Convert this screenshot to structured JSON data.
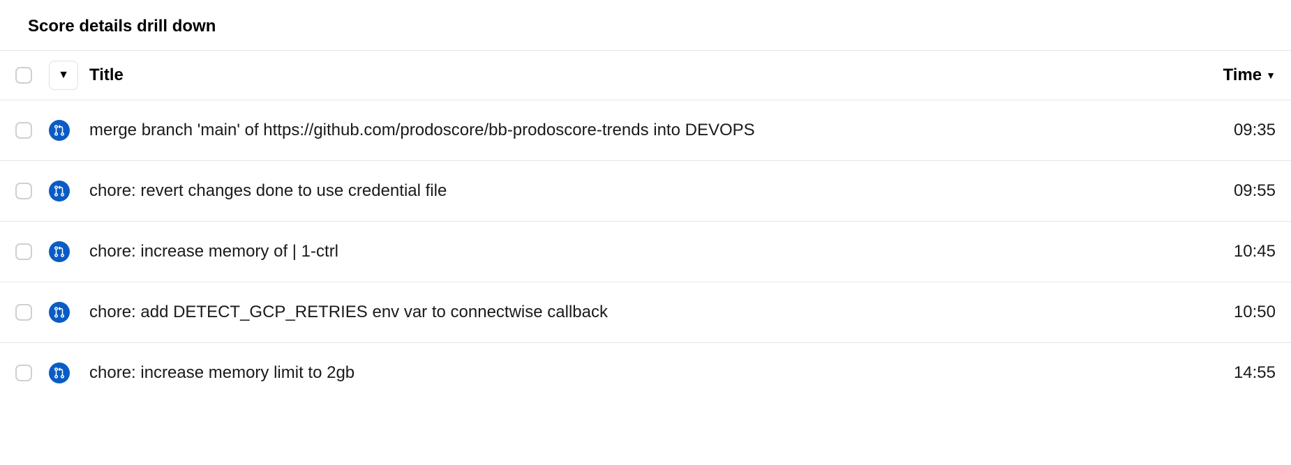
{
  "page_title": "Score details drill down",
  "columns": {
    "title_label": "Title",
    "time_label": "Time"
  },
  "rows": [
    {
      "title": "merge branch 'main' of https://github.com/prodoscore/bb-prodoscore-trends into DEVOPS",
      "time": "09:35"
    },
    {
      "title": "chore: revert changes done to use credential file",
      "time": "09:55"
    },
    {
      "title": "chore: increase memory of  | 1-ctrl",
      "time": "10:45"
    },
    {
      "title": "chore: add DETECT_GCP_RETRIES env var to connectwise callback",
      "time": "10:50"
    },
    {
      "title": "chore: increase memory limit to 2gb",
      "time": "14:55"
    }
  ]
}
